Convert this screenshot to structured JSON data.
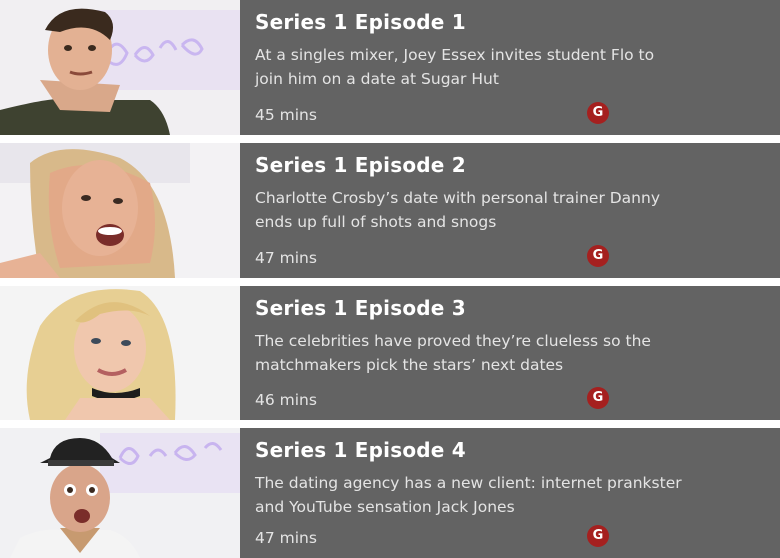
{
  "episodes": [
    {
      "title": "Series 1 Episode 1",
      "description": "At a singles mixer, Joey Essex invites student Flo to join him on a date at Sugar Hut",
      "duration": "45 mins",
      "rating": "G",
      "thumbnail_icon": "contestant-portrait-icon"
    },
    {
      "title": "Series 1 Episode 2",
      "description": "Charlotte Crosby’s date with personal trainer Danny ends up full of shots and snogs",
      "duration": "47 mins",
      "rating": "G",
      "thumbnail_icon": "contestant-portrait-icon"
    },
    {
      "title": "Series 1 Episode 3",
      "description": "The celebrities have proved they’re clueless so the matchmakers pick the stars’ next dates",
      "duration": "46 mins",
      "rating": "G",
      "thumbnail_icon": "contestant-portrait-icon"
    },
    {
      "title": "Series 1 Episode 4",
      "description": "The dating agency has a new client: internet prankster and YouTube sensation Jack Jones",
      "duration": "47 mins",
      "rating": "G",
      "thumbnail_icon": "contestant-portrait-icon"
    }
  ],
  "colors": {
    "row_background": "#636363",
    "rating_badge": "#a5201f",
    "title_text": "#ffffff",
    "body_text": "#e4e4e4"
  }
}
